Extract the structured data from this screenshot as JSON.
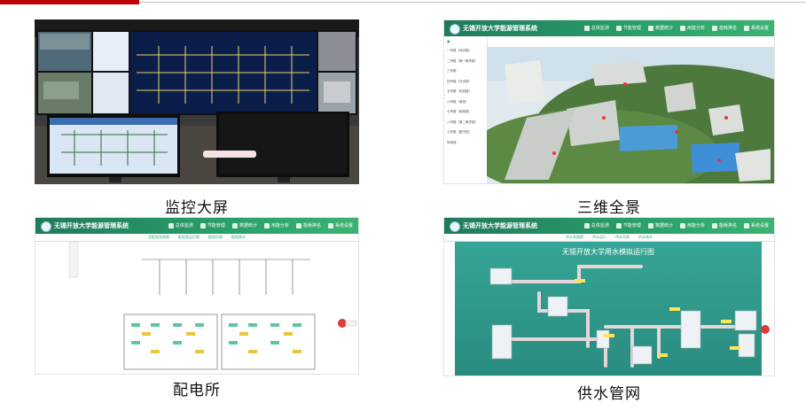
{
  "panels": [
    {
      "caption": "监控大屏"
    },
    {
      "caption": "三维全景",
      "app": {
        "title": "无锡开放大学能源管理系统",
        "nav": [
          "总体监测",
          "节能管理",
          "数据统计",
          "用能分析",
          "能耗排名",
          "系统设置"
        ],
        "sidebar": [
          "一号楼（综合楼）",
          "二号楼（第一教学楼）",
          "三号楼",
          "四号楼（艺术楼）",
          "五号楼（实验楼）",
          "六号楼（食堂）",
          "七号楼（宿舍楼）",
          "八号楼（第二教学楼）",
          "九号楼（图书馆）",
          "体育馆"
        ]
      }
    },
    {
      "caption": "配电所",
      "app": {
        "title": "无锡开放大学能源管理系统",
        "nav": [
          "总体监测",
          "节能管理",
          "数据统计",
          "用能分析",
          "能耗排名",
          "系统设置"
        ],
        "tabs": [
          "总配电系统图",
          "配电室运行图",
          "配电列表",
          "配电统计"
        ]
      }
    },
    {
      "caption": "供水管网",
      "app": {
        "title": "无锡开放大学能源管理系统",
        "nav": [
          "总体监测",
          "节能管理",
          "数据统计",
          "用能分析",
          "能耗排名",
          "系统设置"
        ],
        "tabs": [
          "供水系统图",
          "供水运行",
          "供水列表",
          "供水统计"
        ],
        "diagram_title": "无锡开放大学用水模拟运行图"
      }
    }
  ],
  "colors": {
    "accent_red": "#c00000",
    "header_green": "#2aa06a",
    "pipe": "#d8c8cc",
    "teal_bg": "#2f9c8e"
  }
}
